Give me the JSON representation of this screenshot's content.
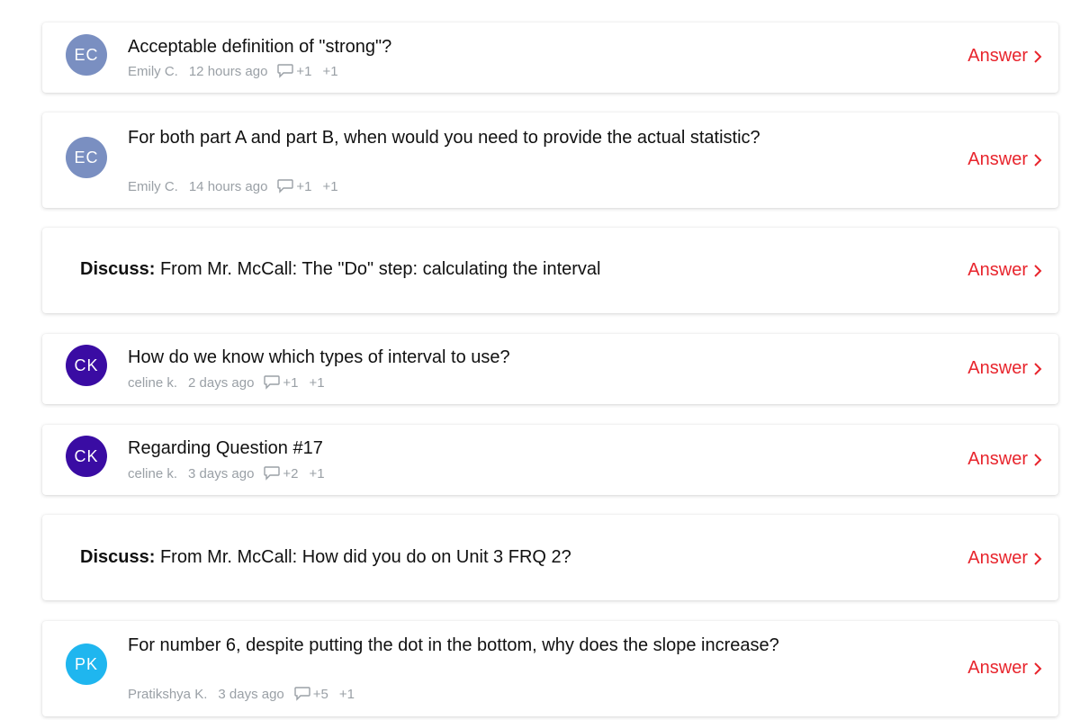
{
  "colors": {
    "accent": "#e8252d",
    "avatar_ec": "#7a8fc1",
    "avatar_ck": "#3a0ca3",
    "avatar_pk": "#1fb6ef",
    "meta": "#9aa0a6"
  },
  "items": [
    {
      "type": "question",
      "avatar": "EC",
      "title": "Acceptable definition of \"strong\"?",
      "author": "Emily C.",
      "time": "12 hours ago",
      "comments": "+1",
      "votes": "+1",
      "action": "Answer",
      "icons": [
        "comment-icon",
        "chevron-right-icon"
      ]
    },
    {
      "type": "question",
      "avatar": "EC",
      "title": "For both part A and part B, when would you need to provide the actual statistic?",
      "author": "Emily C.",
      "time": "14 hours ago",
      "comments": "+1",
      "votes": "+1",
      "action": "Answer"
    },
    {
      "type": "discussion",
      "prefix": "Discuss:",
      "title": "From Mr. McCall: The \"Do\" step: calculating the interval",
      "action": "Answer"
    },
    {
      "type": "question",
      "avatar": "CK",
      "title": "How do we know which types of interval to use?",
      "author": "celine k.",
      "time": "2 days ago",
      "comments": "+1",
      "votes": "+1",
      "action": "Answer"
    },
    {
      "type": "question",
      "avatar": "CK",
      "title": "Regarding Question #17",
      "author": "celine k.",
      "time": "3 days ago",
      "comments": "+2",
      "votes": "+1",
      "action": "Answer"
    },
    {
      "type": "discussion",
      "prefix": "Discuss:",
      "title": "From Mr. McCall: How did you do on Unit 3 FRQ 2?",
      "action": "Answer"
    },
    {
      "type": "question",
      "avatar": "PK",
      "title": "For number 6, despite putting the dot in the bottom, why does the slope increase?",
      "author": "Pratikshya K.",
      "time": "3 days ago",
      "comments": "+5",
      "votes": "+1",
      "action": "Answer"
    }
  ]
}
